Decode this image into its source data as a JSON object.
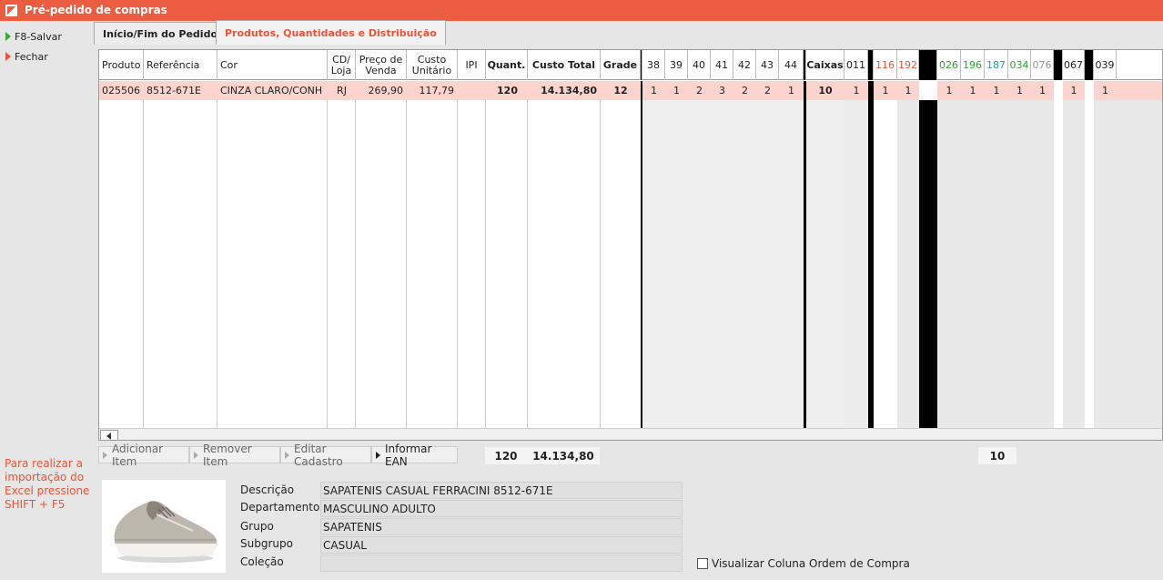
{
  "window": {
    "title": "Pré-pedido de compras"
  },
  "sidebar": {
    "save_label": "F8-Salvar",
    "close_label": "Fechar",
    "hint": "Para realizar a importação do Excel pressione SHIFT + F5"
  },
  "tabs": [
    {
      "label": "Início/Fim do Pedido",
      "active": false
    },
    {
      "label": "Produtos, Quantidades e Distribuição",
      "active": true
    }
  ],
  "grid": {
    "headers": {
      "produto": "Produto",
      "referencia": "Referência",
      "cor": "Cor",
      "cd_loja_1": "CD/",
      "cd_loja_2": "Loja",
      "preco_1": "Preço de",
      "preco_2": "Venda",
      "custo_1": "Custo",
      "custo_2": "Unitário",
      "ipi": "IPI",
      "quant": "Quant.",
      "custo_total": "Custo Total",
      "grade": "Grade",
      "s38": "38",
      "s39": "39",
      "s40": "40",
      "s41": "41",
      "s42": "42",
      "s43": "43",
      "s44": "44",
      "caixas": "Caixas",
      "st011": "011",
      "st116": "116",
      "st192": "192",
      "st026": "026",
      "st196": "196",
      "st187": "187",
      "st034": "034",
      "st076": "076",
      "st067": "067",
      "st039": "039"
    },
    "row": {
      "produto": "025506",
      "referencia": "8512-671E",
      "cor": "CINZA CLARO/CONH",
      "cd_loja": "RJ",
      "preco": "269,90",
      "custo": "117,79",
      "ipi": "",
      "quant": "120",
      "custo_total": "14.134,80",
      "grade": "12",
      "s38": "1",
      "s39": "1",
      "s40": "2",
      "s41": "3",
      "s42": "2",
      "s43": "2",
      "s44": "1",
      "caixas": "10",
      "st011": "1",
      "st116": "1",
      "st192": "1",
      "st026": "1",
      "st196": "1",
      "st187": "1",
      "st034": "1",
      "st076": "1",
      "st067": "1",
      "st039": "1"
    },
    "store_colors": {
      "red": "#e8553a",
      "green": "#2e9e2e",
      "teal": "#2aa198",
      "gray": "#999999"
    }
  },
  "footer": {
    "add": "Adicionar Item",
    "remove": "Remover Item",
    "edit": "Editar Cadastro",
    "ean": "Informar EAN",
    "total_quant": "120",
    "total_custo": "14.134,80",
    "total_caixas": "10"
  },
  "details": {
    "descricao_label": "Descrição",
    "descricao": "SAPATENIS CASUAL FERRACINI 8512-671E",
    "departamento_label": "Departamento",
    "departamento": "MASCULINO ADULTO",
    "grupo_label": "Grupo",
    "grupo": "SAPATENIS",
    "subgrupo_label": "Subgrupo",
    "subgrupo": "CASUAL",
    "colecao_label": "Coleção",
    "colecao": "",
    "checkbox_label": "Visualizar Coluna Ordem de Compra"
  }
}
